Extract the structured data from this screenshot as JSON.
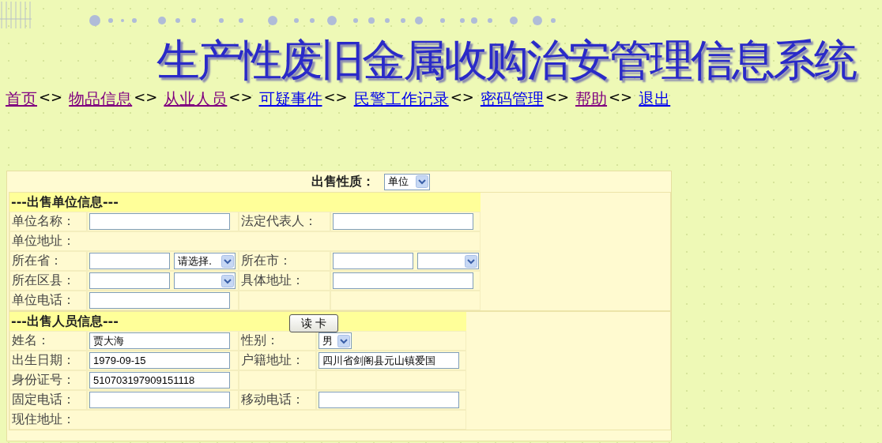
{
  "title": "生产性废旧金属收购治安管理信息系统",
  "nav": [
    {
      "label": "首页",
      "visited": true,
      "separator": "<>"
    },
    {
      "label": "物品信息",
      "visited": true,
      "separator": "<>"
    },
    {
      "label": "从业人员",
      "visited": true,
      "separator": "<>"
    },
    {
      "label": "可疑事件",
      "visited": false,
      "separator": "<>"
    },
    {
      "label": "民警工作记录",
      "visited": false,
      "separator": "<>"
    },
    {
      "label": "密码管理",
      "visited": false,
      "separator": "<>"
    },
    {
      "label": "帮助",
      "visited": true,
      "separator": "<>"
    },
    {
      "label": "退出",
      "visited": false
    }
  ],
  "sale_type": {
    "label": "出售性质：",
    "value": "单位"
  },
  "unit_section": {
    "heading": "---出售单位信息---",
    "rows": [
      [
        {
          "kind": "label",
          "text": "单位名称："
        },
        {
          "kind": "field"
        },
        {
          "kind": "label",
          "text": "法定代表人："
        },
        {
          "kind": "field"
        }
      ],
      [
        {
          "kind": "label",
          "text": "单位地址："
        }
      ],
      [
        {
          "kind": "label",
          "text": "所在省："
        },
        {
          "kind": "field-select",
          "option": "请选择."
        },
        {
          "kind": "label",
          "text": "所在市："
        },
        {
          "kind": "field-select"
        }
      ],
      [
        {
          "kind": "label",
          "text": "所在区县："
        },
        {
          "kind": "field-select"
        },
        {
          "kind": "label",
          "text": "具体地址："
        },
        {
          "kind": "field"
        }
      ],
      [
        {
          "kind": "label",
          "text": "单位电话："
        },
        {
          "kind": "field"
        },
        {
          "kind": "blank"
        },
        {
          "kind": "blank"
        }
      ]
    ]
  },
  "person_section": {
    "heading": "---出售人员信息---",
    "button": "读 卡",
    "rows": [
      [
        {
          "kind": "label",
          "text": "姓名："
        },
        {
          "kind": "field",
          "value": "贾大海"
        },
        {
          "kind": "label",
          "text": "性别："
        },
        {
          "kind": "select",
          "option": "男"
        }
      ],
      [
        {
          "kind": "label",
          "text": "出生日期："
        },
        {
          "kind": "field",
          "value": "1979-09-15"
        },
        {
          "kind": "label",
          "text": "户籍地址："
        },
        {
          "kind": "field",
          "value": "四川省剑阁县元山镇爱国"
        }
      ],
      [
        {
          "kind": "label",
          "text": "身份证号："
        },
        {
          "kind": "field",
          "value": "510703197909151118"
        },
        {
          "kind": "blank"
        },
        {
          "kind": "blank"
        }
      ],
      [
        {
          "kind": "label",
          "text": "固定电话："
        },
        {
          "kind": "field"
        },
        {
          "kind": "label",
          "text": "移动电话："
        },
        {
          "kind": "field"
        }
      ],
      [
        {
          "kind": "label",
          "text": "现住地址："
        }
      ]
    ]
  }
}
